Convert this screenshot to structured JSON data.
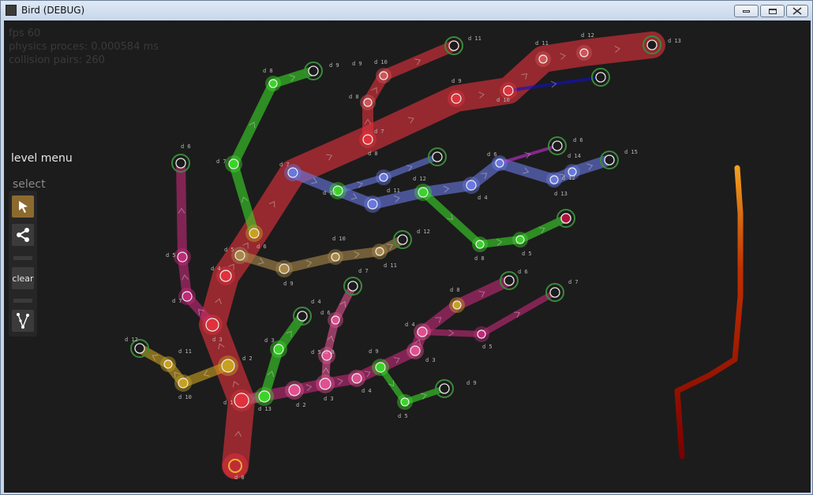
{
  "window": {
    "title": "Bird (DEBUG)"
  },
  "debug": {
    "fps": "fps 60",
    "physics": "physics proces: 0.000584 ms",
    "pairs": "collision pairs: 260"
  },
  "menu": {
    "title": "level menu",
    "select_label": "select",
    "clear_label": "clear",
    "tools": [
      "select-arrow-icon",
      "share-branch-icon",
      "clear",
      "node-graph-icon"
    ]
  },
  "colors": {
    "trunk": "#e0323c",
    "magenta": "#c02a78",
    "green": "#3ad428",
    "olive": "#c8a020",
    "blue": "#6878e0",
    "tan": "#a8884a",
    "pink": "#e05090",
    "salmon": "#d05458",
    "purple": "#c030d0",
    "navy": "#1010c0",
    "leaf_ring": "#3a8a3a",
    "stroke_start": "#f0a020",
    "stroke_end": "#7a0000"
  },
  "labels": [
    "d 0",
    "d 1",
    "d 2",
    "d 3",
    "d 4",
    "d 5",
    "d 6",
    "d 7",
    "d 8",
    "d 9",
    "d 10",
    "d 11",
    "d 12",
    "d 13",
    "d 14",
    "d 15",
    "d 3",
    "d 4",
    "d 5",
    "d 6",
    "d 7",
    "d 8",
    "d 9",
    "d 10",
    "d 11",
    "d 12",
    "d 13",
    "d 5",
    "d 6",
    "d 7",
    "d 8",
    "d 9",
    "d 10",
    "d 11",
    "d 12",
    "d 4",
    "d 5",
    "d 6",
    "d 7",
    "d 8",
    "d 9",
    "d 3",
    "d 4",
    "d 5",
    "d 6",
    "d 7",
    "d 8",
    "d 9",
    "d 10",
    "d 11",
    "d 12",
    "d 13",
    "d 2",
    "d 3",
    "d 4",
    "d 5",
    "d 6",
    "d 7",
    "d 8",
    "d 9",
    "d 10",
    "d 11",
    "d 12",
    "d 13"
  ]
}
